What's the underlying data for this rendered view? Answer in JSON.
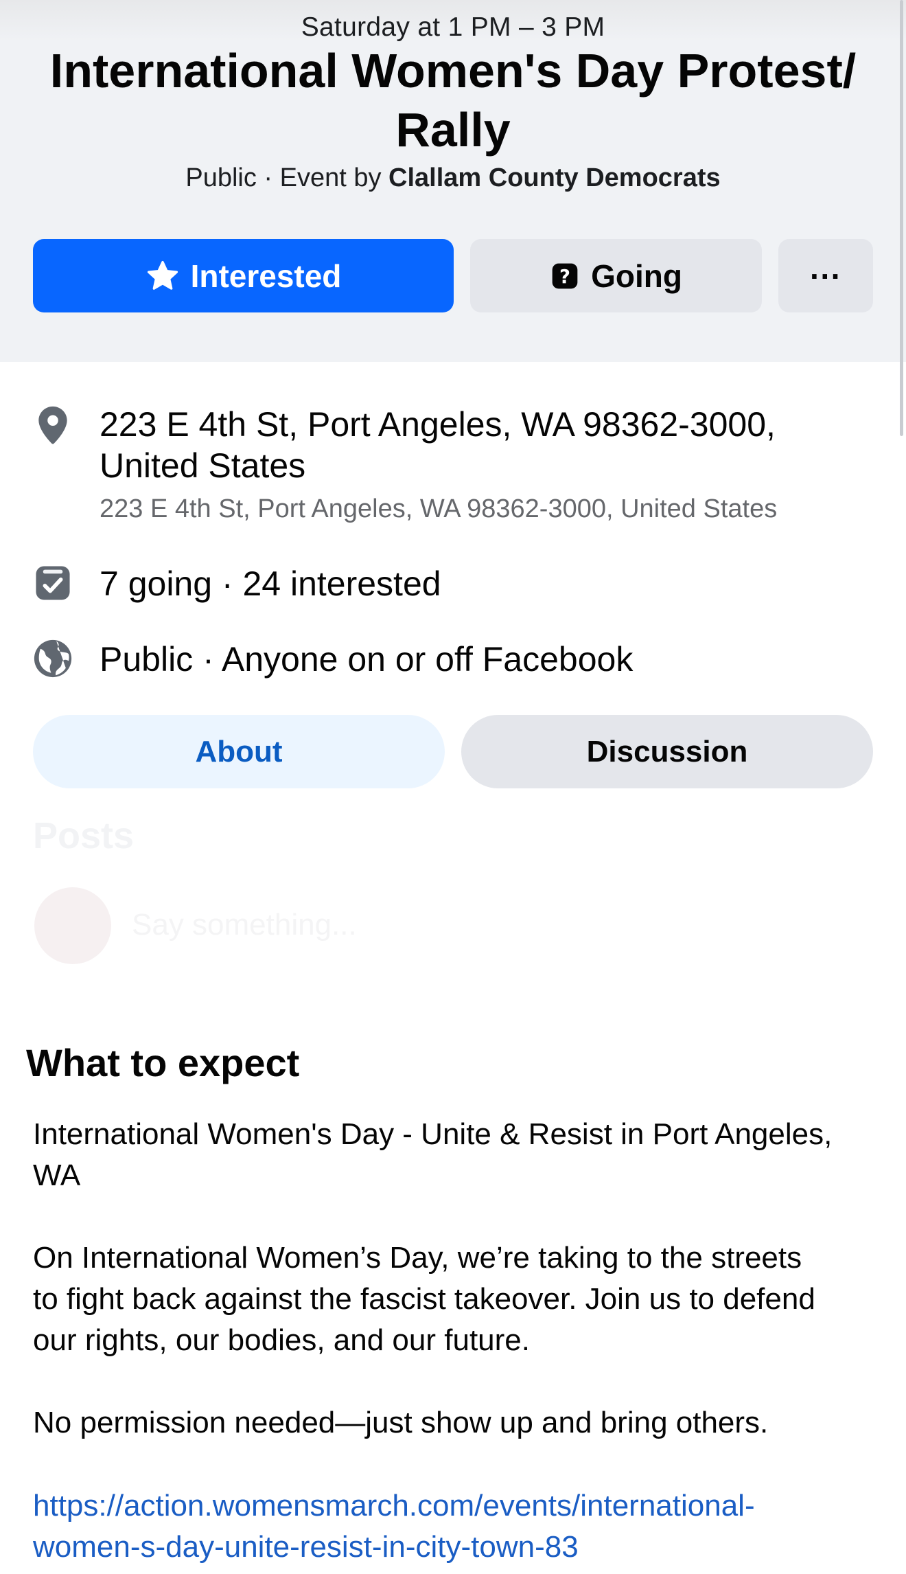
{
  "event": {
    "when": "Saturday at 1 PM – 3 PM",
    "title": "International Women's Day Protest/ Rally",
    "privacy_prefix": "Public · Event by ",
    "host": "Clallam County Democrats"
  },
  "actions": {
    "interested_label": "Interested",
    "going_label": "Going",
    "more_label": "···"
  },
  "details": {
    "address_line1": "223 E 4th St, Port Angeles, WA 98362-3000,",
    "address_line2": "United States",
    "address_sub": "223 E 4th St, Port Angeles, WA 98362-3000, United States",
    "responses": "7 going · 24 interested",
    "visibility": "Public · Anyone on or off Facebook"
  },
  "tabs": {
    "about": "About",
    "discussion": "Discussion"
  },
  "faded": {
    "posts_heading": "Posts",
    "composer_placeholder": "Say something..."
  },
  "expect": {
    "heading": "What to expect",
    "p1_line1": "International Women's Day - Unite & Resist in Port Angeles,",
    "p1_line2": "WA",
    "p2_line1": "On International Women’s Day, we’re taking to the streets",
    "p2_line2": "to fight back against the fascist takeover. Join us to defend",
    "p2_line3": "our rights, our bodies, and our future.",
    "p3": "No permission needed—just show up and bring others.",
    "link_line1": "https://action.womensmarch.com/events/international-",
    "link_line2": "women-s-day-unite-resist-in-city-town-83"
  },
  "colors": {
    "accent": "#0866ff",
    "link": "#1a5dc4",
    "tab_active_bg": "#ebf5ff",
    "button_gray": "#e4e6eb",
    "header_bg": "#f0f2f5"
  },
  "icons": [
    "star-icon",
    "question-calendar-icon",
    "map-pin-icon",
    "calendar-check-icon",
    "globe-icon"
  ]
}
